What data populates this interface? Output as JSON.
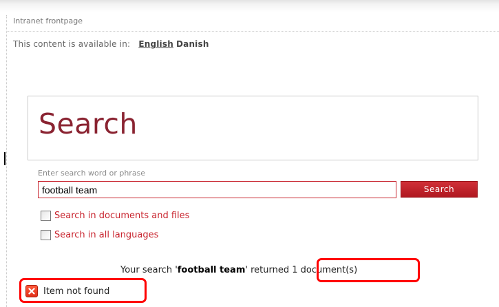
{
  "breadcrumb": "Intranet frontpage",
  "languages": {
    "prefix": "This content is available in:",
    "items": [
      "English",
      "Danish"
    ],
    "active": "English"
  },
  "search": {
    "title": "Search",
    "field_label": "Enter search word or phrase",
    "query": "football team",
    "button_label": "Search",
    "options": [
      {
        "label": "Search in documents and files",
        "checked": false
      },
      {
        "label": "Search in all languages",
        "checked": false
      }
    ]
  },
  "results": {
    "prefix": "Your search '",
    "query": "football team",
    "middle": "' returned ",
    "count_text": "1 document(s)"
  },
  "message": {
    "icon": "error-x-icon",
    "text": "Item not found"
  },
  "colors": {
    "accent": "#c8242e",
    "title": "#8a2331",
    "highlight": "#ff0000"
  }
}
